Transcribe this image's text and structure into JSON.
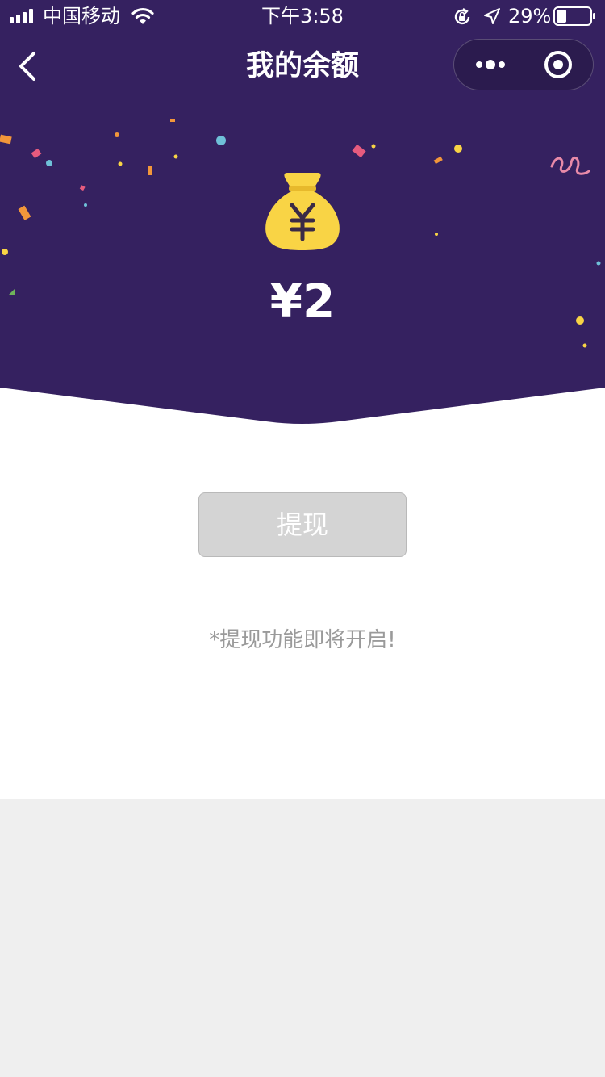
{
  "status_bar": {
    "carrier": "中国移动",
    "time": "下午3:58",
    "battery_percent": "29%",
    "battery_level": 0.29,
    "icons": [
      "signal-icon",
      "wifi-icon",
      "orientation-lock-icon",
      "location-arrow-icon",
      "battery-icon"
    ]
  },
  "nav": {
    "title": "我的余额",
    "back_icon": "chevron-left-icon",
    "more_icon": "more-dots-icon",
    "close_icon": "target-close-icon"
  },
  "hero": {
    "icon": "money-bag-icon",
    "balance": "¥2",
    "background_color": "#352160",
    "bag_color": "#f9d445"
  },
  "main": {
    "withdraw_label": "提现",
    "withdraw_enabled": false,
    "notice": "*提现功能即将开启!"
  }
}
